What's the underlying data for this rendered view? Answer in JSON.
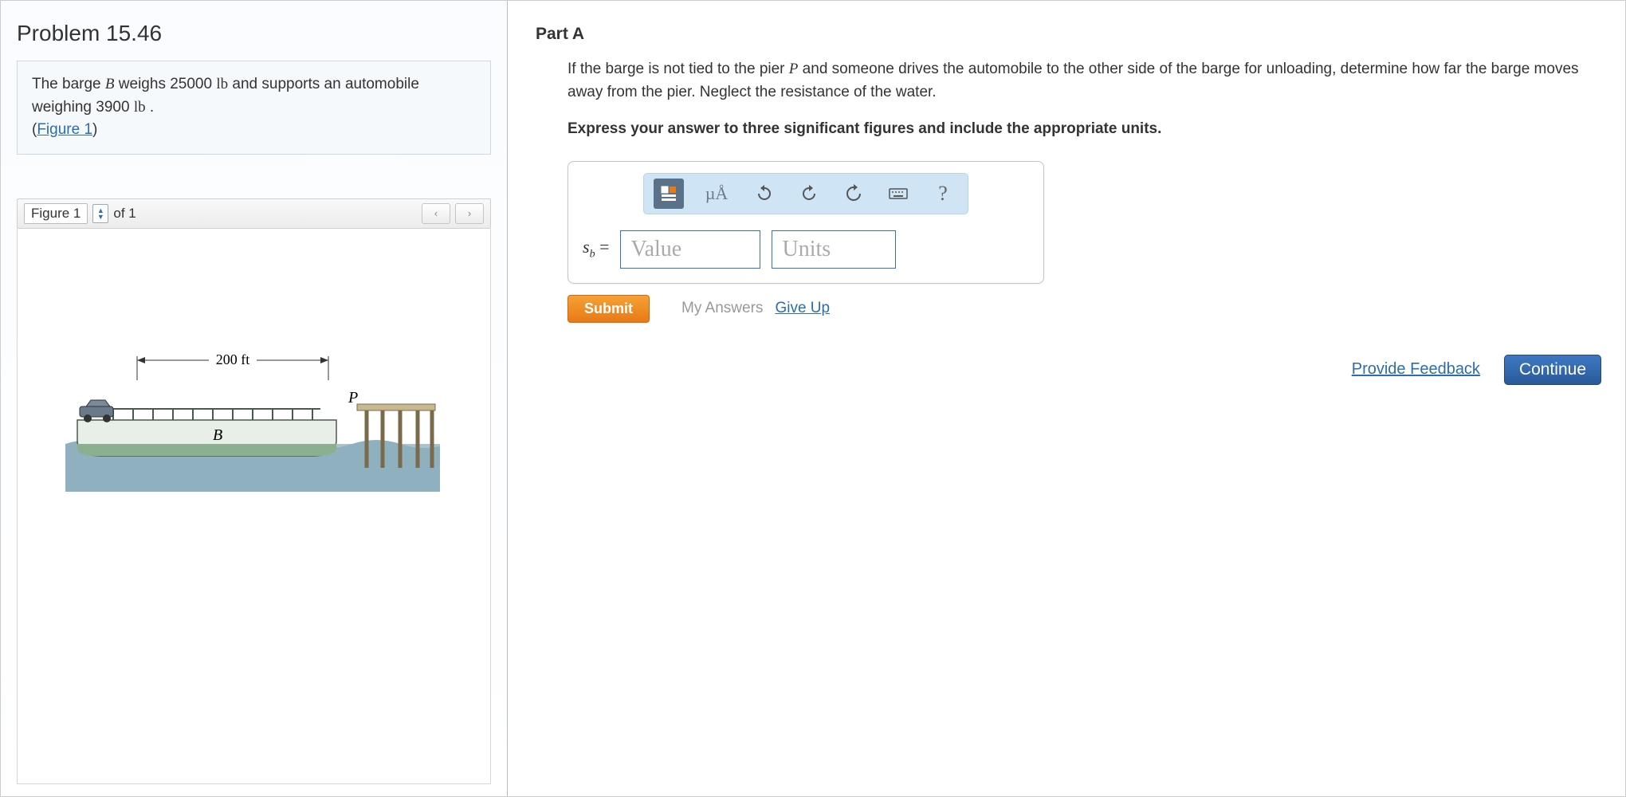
{
  "problem": {
    "title": "Problem 15.46",
    "text_a": "The barge ",
    "var_B": "B",
    "text_b": " weighs 25000 ",
    "unit_lb1": "lb",
    "text_c": " and supports an automobile weighing 3900 ",
    "unit_lb2": "lb",
    "text_d": " .",
    "figure_link": "Figure 1"
  },
  "figure_toolbar": {
    "label": "Figure 1",
    "of_text": "of 1"
  },
  "figure": {
    "dimension": "200 ft",
    "pier_label": "P",
    "barge_label": "B"
  },
  "partA": {
    "title": "Part A",
    "q1a": "If the barge is not tied to the pier ",
    "q1P": "P",
    "q1b": " and someone drives the automobile to the other side of the barge for unloading, determine how far the barge moves away from the pier. Neglect the resistance of the water.",
    "instr": "Express your answer to three significant figures and include the appropriate units."
  },
  "toolbar": {
    "units_tool": "µÅ",
    "help": "?"
  },
  "answer": {
    "var": "s",
    "sub": "b",
    "eq": " = ",
    "value_ph": "Value",
    "units_ph": "Units"
  },
  "actions": {
    "submit": "Submit",
    "my_answers": "My Answers",
    "give_up": "Give Up",
    "feedback": "Provide Feedback",
    "continue": "Continue"
  }
}
